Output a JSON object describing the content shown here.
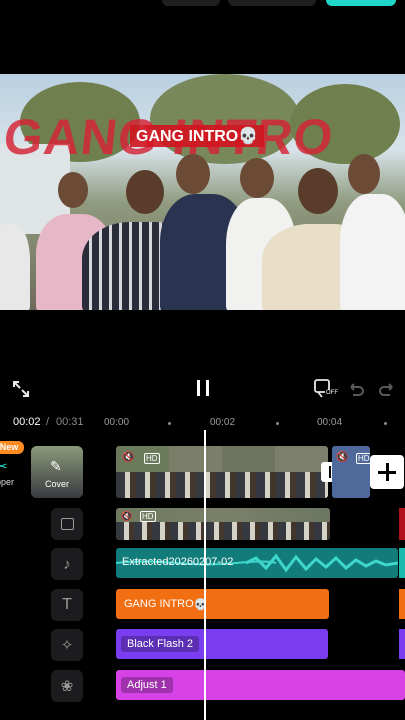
{
  "preview": {
    "big_title": "GANG INTRO",
    "small_title": "GANG INTRO",
    "skull_glyph": "💀"
  },
  "timeline": {
    "current_time": "00:02",
    "separator": "/",
    "total_time": "00:31",
    "ruler_ticks": [
      "00:00",
      "00:02",
      "00:04"
    ]
  },
  "tools": {
    "new_badge": "New",
    "left_partial_label": "pper",
    "cover_label": "Cover"
  },
  "tracks": {
    "audio_label": "Extracted20260207-02",
    "text_clip": "GANG INTRO",
    "effect_clip": "Black Flash 2",
    "adjust_clip": "Adjust 1"
  },
  "badges": {
    "hd": "HD",
    "off": "OFF"
  },
  "colors": {
    "audio_track": "#127c7a",
    "text_track": "#f26e12",
    "effect_track": "#7a3ef0",
    "adjust_track": "#d642e6",
    "accent": "#1fd6c8",
    "red_title": "#d62234"
  }
}
